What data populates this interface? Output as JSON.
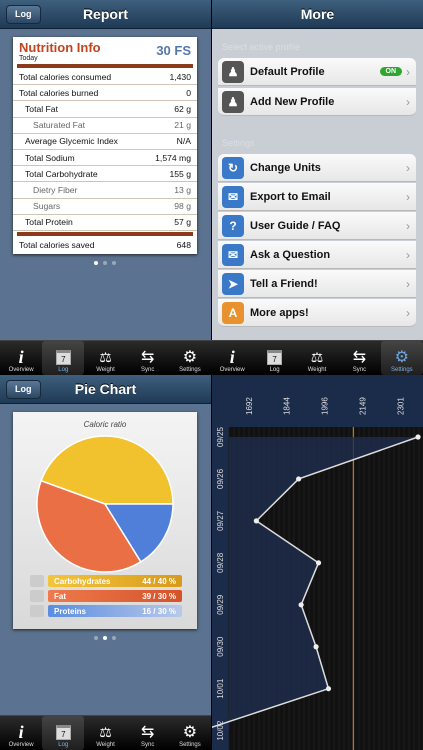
{
  "report": {
    "back": "Log",
    "title": "Report"
  },
  "nutrition": {
    "title": "Nutrition Info",
    "subtitle": "Today",
    "points": "30 FS",
    "rows": [
      {
        "label": "Total calories consumed",
        "value": "1,430"
      },
      {
        "label": "Total calories burned",
        "value": "0"
      },
      {
        "label": "Total Fat",
        "value": "62 g"
      },
      {
        "label": "Saturated Fat",
        "value": "21 g"
      },
      {
        "label": "Average Glycemic Index",
        "value": "N/A"
      },
      {
        "label": "Total Sodium",
        "value": "1,574 mg"
      },
      {
        "label": "Total Carbohydrate",
        "value": "155 g"
      },
      {
        "label": "Dietry Fiber",
        "value": "13 g"
      },
      {
        "label": "Sugars",
        "value": "98 g"
      },
      {
        "label": "Total Protein",
        "value": "57 g"
      }
    ],
    "footer_label": "Total calories saved",
    "footer_value": "648"
  },
  "more": {
    "title": "More",
    "section1": "Select active profile",
    "section2": "Settings",
    "toggle": "ON",
    "items": [
      {
        "label": "Default Profile",
        "icon": "person-icon"
      },
      {
        "label": "Add New Profile",
        "icon": "person-add-icon"
      },
      {
        "label": "Change Units",
        "icon": "units-icon"
      },
      {
        "label": "Export to Email",
        "icon": "mail-icon"
      },
      {
        "label": "User Guide / FAQ",
        "icon": "question-icon"
      },
      {
        "label": "Ask a Question",
        "icon": "chat-icon"
      },
      {
        "label": "Tell a Friend!",
        "icon": "share-icon"
      },
      {
        "label": "More apps!",
        "icon": "apps-icon"
      }
    ]
  },
  "tabs": [
    {
      "label": "Overview"
    },
    {
      "label": "Log",
      "day": "7"
    },
    {
      "label": "Weight"
    },
    {
      "label": "Sync"
    },
    {
      "label": "Settings"
    }
  ],
  "pie": {
    "back": "Log",
    "title": "Pie Chart"
  },
  "chart_data": [
    {
      "type": "pie",
      "title": "Caloric ratio",
      "series": [
        {
          "name": "Carbohydrates",
          "value": 44,
          "target": "40 %",
          "color": "#f2c12e",
          "label": "44 / 40 %"
        },
        {
          "name": "Fat",
          "value": 39,
          "target": "30 %",
          "color": "#ea6f45",
          "label": "39 / 30 %"
        },
        {
          "name": "Proteins",
          "value": 16,
          "target": "30 %",
          "color": "#4f7fd9",
          "label": "16 / 30 %"
        }
      ]
    },
    {
      "type": "line",
      "categories": [
        "09/25",
        "09/26",
        "09/27",
        "09/28",
        "09/29",
        "09/30",
        "10/01",
        "10/02"
      ],
      "values": [
        2360,
        1880,
        1710,
        1960,
        1890,
        1950,
        2000,
        1490
      ],
      "x_ticks": [
        "1692",
        "1844",
        "1996",
        "2149",
        "2301"
      ],
      "reference_line": 2100,
      "xlim": [
        1600,
        2380
      ]
    }
  ]
}
